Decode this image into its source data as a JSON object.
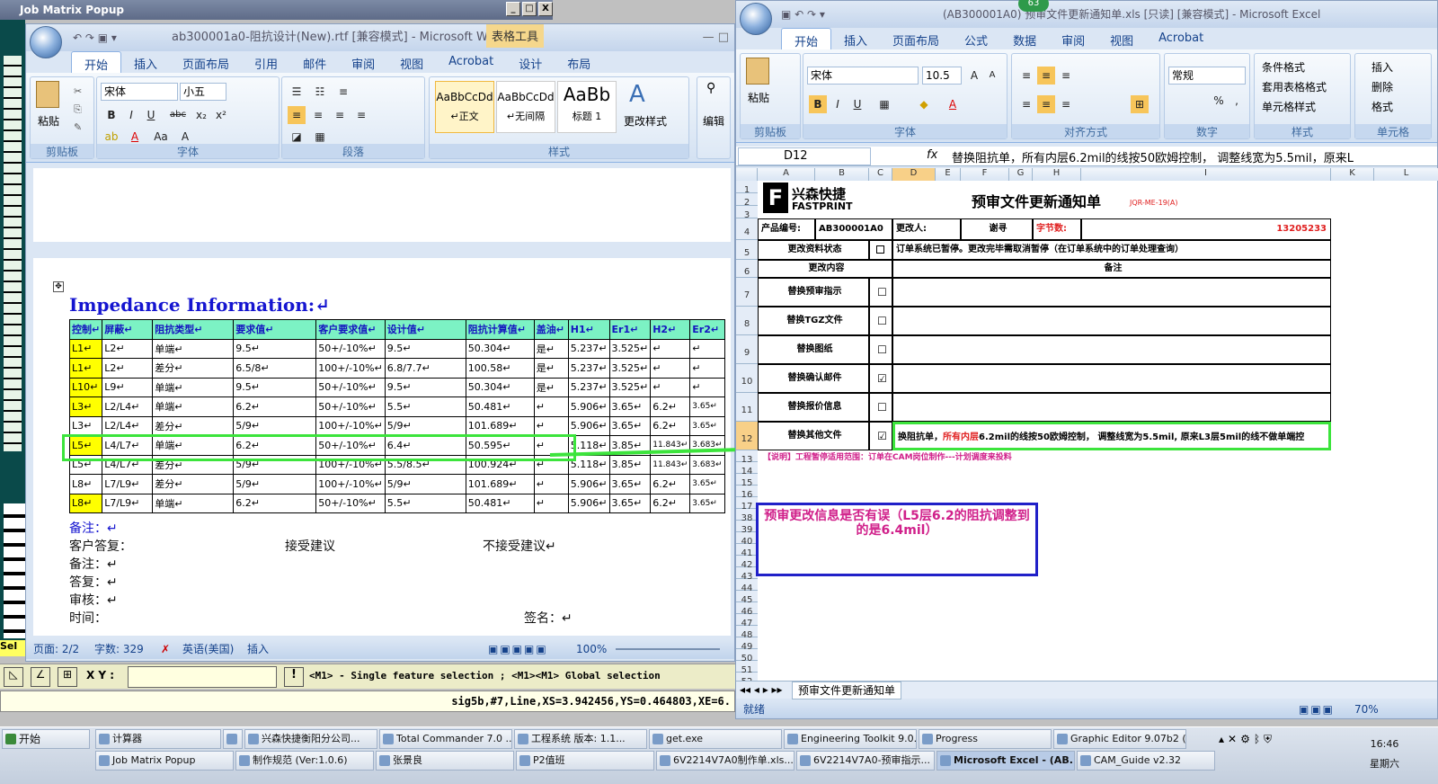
{
  "jobmatrix": {
    "title": "Job Matrix Popup",
    "btn_min": "_",
    "btn_max": "□",
    "btn_close": "X",
    "sel": "Sel"
  },
  "word": {
    "title": "ab300001a0-阻抗设计(New).rtf [兼容模式] - Microsoft Wo...",
    "tool_tab": "表格工具",
    "tabs": [
      "开始",
      "插入",
      "页面布局",
      "引用",
      "邮件",
      "审阅",
      "视图",
      "Acrobat",
      "设计",
      "布局"
    ],
    "paste": "粘贴",
    "font_name": "宋体",
    "font_size": "小五",
    "groups": [
      "剪贴板",
      "字体",
      "段落",
      "样式"
    ],
    "styles": [
      {
        "preview": "AaBbCcDd",
        "name": "↵正文"
      },
      {
        "preview": "AaBbCcDd",
        "name": "↵无间隔"
      },
      {
        "preview": "AaBb",
        "name": "标题 1"
      }
    ],
    "change_styles": "更改样式",
    "edit": "编辑",
    "impedance_title": "Impedance Information:↵",
    "headers": [
      "控制↵",
      "屏蔽↵",
      "阻抗类型↵",
      "要求值↵",
      "客户要求值↵",
      "设计值↵",
      "阻抗计算值↵",
      "盖油↵",
      "H1↵",
      "Er1↵",
      "H2↵",
      "Er2↵"
    ],
    "rows": [
      [
        "L1↵",
        "L2↵",
        "单端↵",
        "9.5↵",
        "50+/-10%↵",
        "9.5↵",
        "50.304↵",
        "是↵",
        "5.237↵",
        "3.525↵",
        "↵",
        "↵"
      ],
      [
        "L1↵",
        "L2↵",
        "差分↵",
        "6.5/8↵",
        "100+/-10%↵",
        "6.8/7.7↵",
        "100.58↵",
        "是↵",
        "5.237↵",
        "3.525↵",
        "↵",
        "↵"
      ],
      [
        "L10↵",
        "L9↵",
        "单端↵",
        "9.5↵",
        "50+/-10%↵",
        "9.5↵",
        "50.304↵",
        "是↵",
        "5.237↵",
        "3.525↵",
        "↵",
        "↵"
      ],
      [
        "L3↵",
        "L2/L4↵",
        "单端↵",
        "6.2↵",
        "50+/-10%↵",
        "5.5↵",
        "50.481↵",
        "↵",
        "5.906↵",
        "3.65↵",
        "6.2↵",
        "3.65↵"
      ],
      [
        "L3↵",
        "L2/L4↵",
        "差分↵",
        "5/9↵",
        "100+/-10%↵",
        "5/9↵",
        "101.689↵",
        "↵",
        "5.906↵",
        "3.65↵",
        "6.2↵",
        "3.65↵"
      ],
      [
        "L5↵",
        "L4/L7↵",
        "单端↵",
        "6.2↵",
        "50+/-10%↵",
        "6.4↵",
        "50.595↵",
        "↵",
        "5.118↵",
        "3.85↵",
        "11.843↵",
        "3.683↵"
      ],
      [
        "L5↵",
        "L4/L7↵",
        "差分↵",
        "5/9↵",
        "100+/-10%↵",
        "5.5/8.5↵",
        "100.924↵",
        "↵",
        "5.118↵",
        "3.85↵",
        "11.843↵",
        "3.683↵"
      ],
      [
        "L8↵",
        "L7/L9↵",
        "差分↵",
        "5/9↵",
        "100+/-10%↵",
        "5/9↵",
        "101.689↵",
        "↵",
        "5.906↵",
        "3.65↵",
        "6.2↵",
        "3.65↵"
      ],
      [
        "L8↵",
        "L7/L9↵",
        "单端↵",
        "6.2↵",
        "50+/-10%↵",
        "5.5↵",
        "50.481↵",
        "↵",
        "5.906↵",
        "3.65↵",
        "6.2↵",
        "3.65↵"
      ]
    ],
    "remark1": "备注：↵",
    "reply": "客户答复：",
    "accept": "接受建议",
    "reject": "不接受建议↵",
    "remark2": "备注：↵",
    "answer": "答复：↵",
    "review": "审核：↵",
    "time": "时间：",
    "sign": "签名：↵",
    "status": {
      "page": "页面: 2/2",
      "words": "字数: 329",
      "lang": "英语(美国)",
      "mode": "插入",
      "zoom": "100%"
    }
  },
  "excel": {
    "title": "(AB300001A0) 预审文件更新通知单.xls [只读] [兼容模式] - Microsoft Excel",
    "badge": "63",
    "tabs": [
      "开始",
      "插入",
      "页面布局",
      "公式",
      "数据",
      "审阅",
      "视图",
      "Acrobat"
    ],
    "font_name": "宋体",
    "font_size": "10.5",
    "num_format": "常规",
    "groups": [
      "剪贴板",
      "字体",
      "对齐方式",
      "数字",
      "样式",
      "单元格"
    ],
    "style_items": [
      "条件格式",
      "套用表格格式",
      "单元格样式"
    ],
    "cell_items": [
      "插入",
      "删除",
      "格式"
    ],
    "namebox": "D12",
    "formula": "替换阻抗单，所有内层6.2mil的线按50欧姆控制， 调整线宽为5.5mil，原来L",
    "cols": [
      "A",
      "B",
      "C",
      "D",
      "E",
      "F",
      "G",
      "H",
      "I",
      "K",
      "L"
    ],
    "rows_top": [
      "1",
      "2",
      "3",
      "4",
      "5",
      "6",
      "7",
      "8",
      "9",
      "10",
      "11",
      "12",
      "13",
      "14",
      "15",
      "16",
      "17",
      "38",
      "39",
      "40",
      "41",
      "42",
      "43",
      "44",
      "45",
      "46",
      "47",
      "48",
      "49",
      "50",
      "51",
      "52",
      "53"
    ],
    "logo_cn": "兴森快捷",
    "logo_en": "FASTPRINT",
    "sheet_title": "预审文件更新通知单",
    "code": "JQR-ME-19(A)",
    "product_label": "产品编号:",
    "product": "AB300001A0",
    "changer_label": "更改人:",
    "changer": "谢寻",
    "count_label": "字节数:",
    "count": "13205233",
    "status_label": "更改资料状态",
    "status_text": "订单系统已暂停。更改完毕需取消暂停（在订单系统中的订单处理查询）",
    "content_label": "更改内容",
    "remark_label": "备注",
    "items": [
      {
        "label": "替换预审指示",
        "checked": "☐"
      },
      {
        "label": "替换TGZ文件",
        "checked": "☐"
      },
      {
        "label": "替换图纸",
        "checked": "☐"
      },
      {
        "label": "替换确认邮件",
        "checked": "☑"
      },
      {
        "label": "替换报价信息",
        "checked": "☐"
      },
      {
        "label": "替换其他文件",
        "checked": "☑"
      }
    ],
    "d12_pre": "换阻抗单，",
    "d12_red": "所有内层",
    "d12_post": "6.2mil的线按50欧姆控制， 调整线宽为5.5mil, 原来L3层5mil的线不做单端控",
    "note13": "【说明】工程暂停适用范围：订单在CAM岗位制作---计划调度来投料",
    "annot": "预审更改信息是否有误（L5层6.2的阻抗调整到的是6.4mil）",
    "sheet_tab": "预审文件更新通知单",
    "ready": "就绪",
    "zoom": "70%"
  },
  "cmd": {
    "xy": "X Y :",
    "hint": "<M1> - Single feature selection ; <M1><M1> Global selection",
    "info": "sig5b,#7,Line,XS=3.942456,YS=0.464803,XE=6."
  },
  "taskbar": {
    "start": "开始",
    "items1": [
      "计算器",
      "",
      "兴森快捷衡阳分公司...",
      "Total Commander 7.0 ...",
      "工程系统  版本: 1.1...",
      "get.exe",
      "Engineering Toolkit 9.0...",
      "Progress",
      "Graphic Editor 9.07b2 (..."
    ],
    "items2": [
      "Job Matrix Popup",
      "制作规范 (Ver:1.0.6)",
      "张景良",
      "P2值班",
      "6V2214V7A0制作单.xls...",
      "6V2214V7A0-预审指示...",
      "Microsoft Excel - (AB...",
      "CAM_Guide v2.32"
    ],
    "time": "16:46",
    "day": "星期六"
  }
}
